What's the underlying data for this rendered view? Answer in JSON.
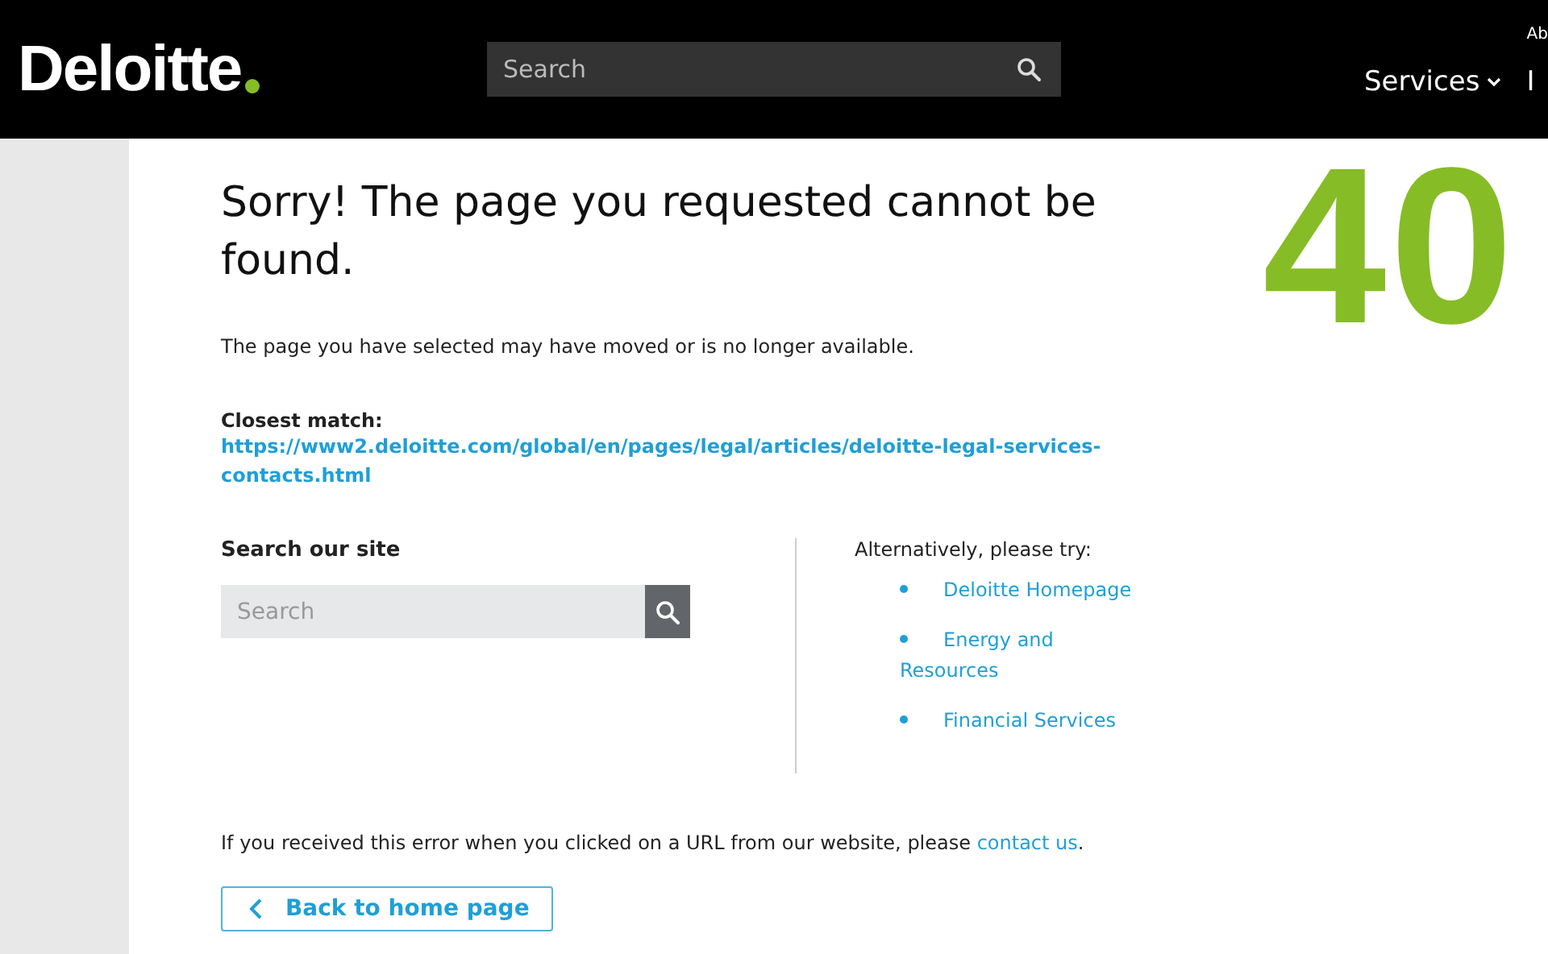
{
  "header": {
    "logo": "Deloitte",
    "search": {
      "placeholder": "Search"
    },
    "utility_link": "Ab",
    "nav": [
      {
        "label": "Services",
        "has_menu": true
      },
      {
        "label": "I",
        "has_menu": false
      }
    ]
  },
  "error": {
    "code": "40",
    "title": "Sorry! The page you requested cannot be found.",
    "message": "The page you have selected may have moved or is no longer available.",
    "closest_match": {
      "label": "Closest match:",
      "url": "https://www2.deloitte.com/global/en/pages/legal/articles/deloitte-legal-services-contacts.html"
    }
  },
  "site_search": {
    "heading": "Search our site",
    "placeholder": "Search"
  },
  "alternatives": {
    "heading": "Alternatively, please try:",
    "links": [
      "Deloitte Homepage",
      "Energy and Resources",
      "Financial Services"
    ]
  },
  "note": {
    "text": "If you received this error when you clicked on a URL from our website, please ",
    "link": "contact us",
    "end": "."
  },
  "back_button": "Back to home page"
}
